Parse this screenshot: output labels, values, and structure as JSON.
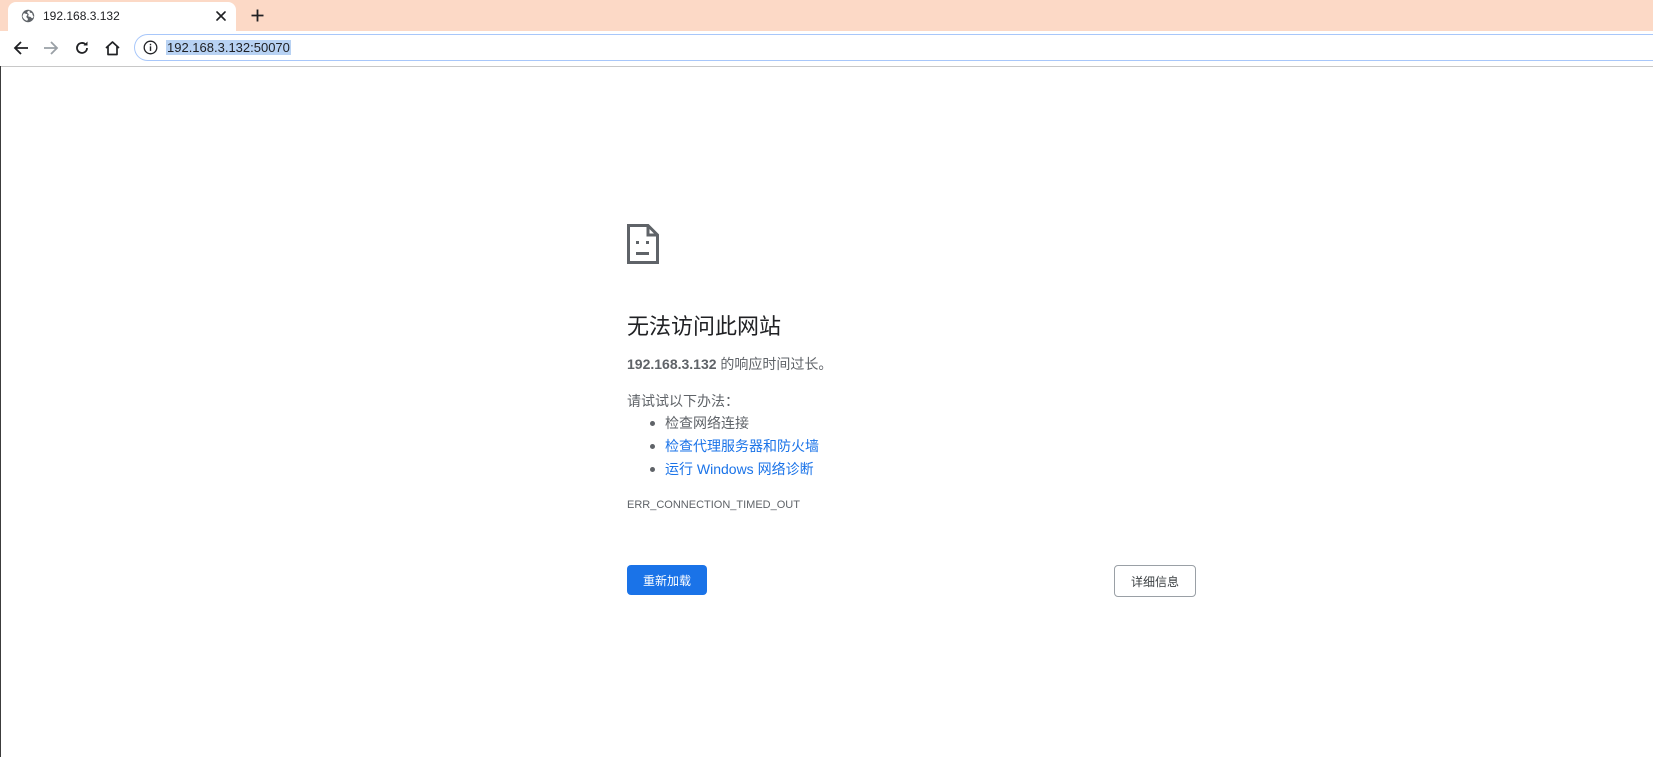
{
  "tab": {
    "title": "192.168.3.132",
    "favicon": "globe-icon",
    "close_icon": "close-icon"
  },
  "new_tab_icon": "plus-icon",
  "toolbar": {
    "back_icon": "arrow-left-icon",
    "forward_icon": "arrow-right-icon",
    "reload_icon": "reload-icon",
    "home_icon": "home-icon"
  },
  "omnibox": {
    "info_icon": "info-icon",
    "url": "192.168.3.132:50070"
  },
  "error": {
    "icon": "sad-page-icon",
    "heading": "无法访问此网站",
    "host": "192.168.3.132",
    "summary_suffix": " 的响应时间过长。",
    "suggest_intro": "请试试以下办法：",
    "suggestions": [
      {
        "text": "检查网络连接",
        "link": false
      },
      {
        "text": "检查代理服务器和防火墙",
        "link": true
      },
      {
        "text": "运行 Windows 网络诊断",
        "link": true
      }
    ],
    "code": "ERR_CONNECTION_TIMED_OUT",
    "reload_label": "重新加载",
    "details_label": "详细信息"
  },
  "colors": {
    "tabstrip": "#fcd9c6",
    "accent": "#1a73e8",
    "text_secondary": "#5f6368"
  }
}
